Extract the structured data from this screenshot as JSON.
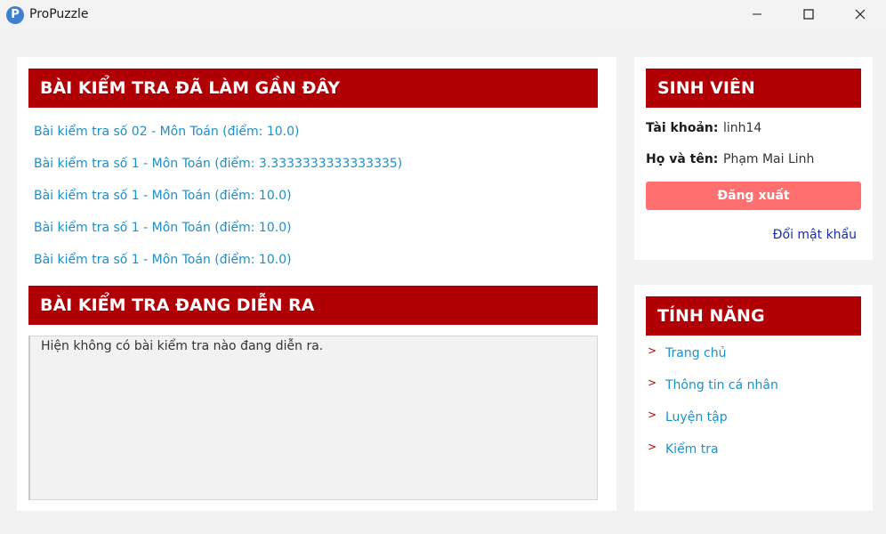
{
  "window": {
    "title": "ProPuzzle",
    "icon_letter": "P"
  },
  "recent": {
    "header": "BÀI KIỂM TRA ĐÃ LÀM GẦN ĐÂY",
    "items": [
      "Bài kiểm tra số 02 - Môn Toán (điểm: 10.0)",
      "Bài kiểm tra số 1 - Môn Toán (điểm: 3.3333333333333335)",
      "Bài kiểm tra số 1 - Môn Toán (điểm: 10.0)",
      "Bài kiểm tra số 1 - Môn Toán (điểm: 10.0)",
      "Bài kiểm tra số 1 - Môn Toán (điểm: 10.0)"
    ]
  },
  "ongoing": {
    "header": "BÀI KIỂM TRA ĐANG DIỄN RA",
    "empty_text": "Hiện không có bài kiểm tra nào đang diễn ra."
  },
  "student": {
    "header": "SINH VIÊN",
    "account_label": "Tài khoản:",
    "account_value": "linh14",
    "name_label": "Họ và tên:",
    "name_value": "Phạm Mai Linh",
    "logout_label": "Đăng xuất",
    "change_password_label": "Đổi mật khẩu"
  },
  "features": {
    "header": "TÍNH NĂNG",
    "items": [
      "Trang chủ",
      "Thông tin cá nhân",
      "Luyện tập",
      "Kiểm tra"
    ]
  },
  "colors": {
    "header_bg": "#b00006",
    "link": "#1e90c8",
    "logout_bg": "#ff6f6f",
    "change_password": "#1a2fa8"
  }
}
